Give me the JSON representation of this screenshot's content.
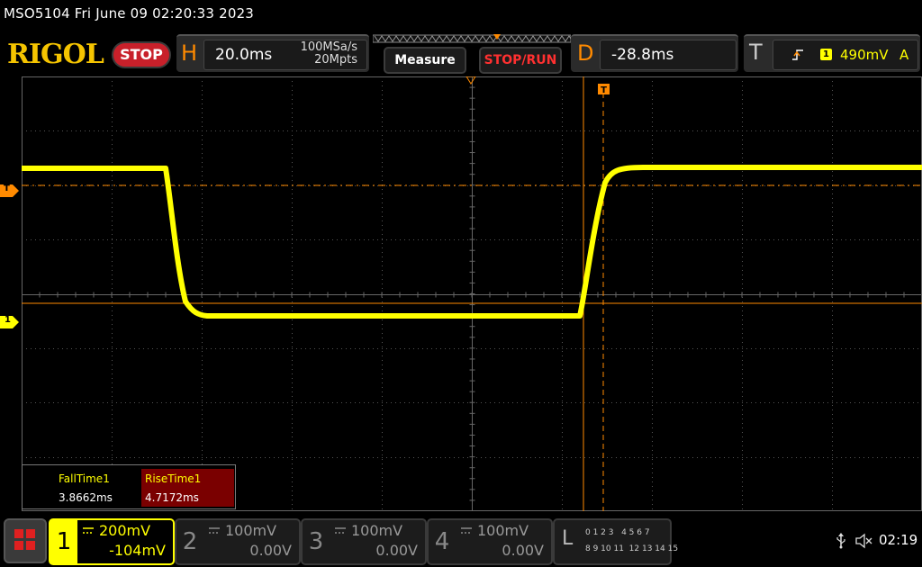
{
  "title_bar": "MSO5104  Fri June 09 02:20:33 2023",
  "brand": "RIGOL",
  "run_state": "STOP",
  "horizontal": {
    "letter": "H",
    "timebase": "20.0ms",
    "sample_rate": "100MSa/s",
    "memory_depth": "20Mpts"
  },
  "buttons": {
    "measure": "Measure",
    "stop_run": "STOP/RUN"
  },
  "delay": {
    "letter": "D",
    "value": "-28.8ms"
  },
  "trigger": {
    "letter": "T",
    "channel": "1",
    "level": "490mV",
    "mode": "A"
  },
  "screen_markers": {
    "trigger_level_label": "T",
    "channel1_label": "1"
  },
  "measurements": {
    "fall": {
      "name": "FallTime1",
      "value": "3.8662ms"
    },
    "rise": {
      "name": "RiseTime1",
      "value": "4.7172ms"
    }
  },
  "channels": [
    {
      "num": "1",
      "scale": "200mV",
      "offset": "-104mV",
      "active": true
    },
    {
      "num": "2",
      "scale": "100mV",
      "offset": "0.00V",
      "active": false
    },
    {
      "num": "3",
      "scale": "100mV",
      "offset": "0.00V",
      "active": false
    },
    {
      "num": "4",
      "scale": "100mV",
      "offset": "0.00V",
      "active": false
    }
  ],
  "logic": {
    "letter": "L",
    "row1": "0 1 2 3   4 5 6 7",
    "row2": "8 9 10 11  12 13 14 15"
  },
  "status": {
    "clock": "02:19"
  },
  "colors": {
    "ch1": "#ffff00",
    "trigger": "#ff8a00",
    "stop": "#c8202a",
    "brand": "#f5c400"
  }
}
